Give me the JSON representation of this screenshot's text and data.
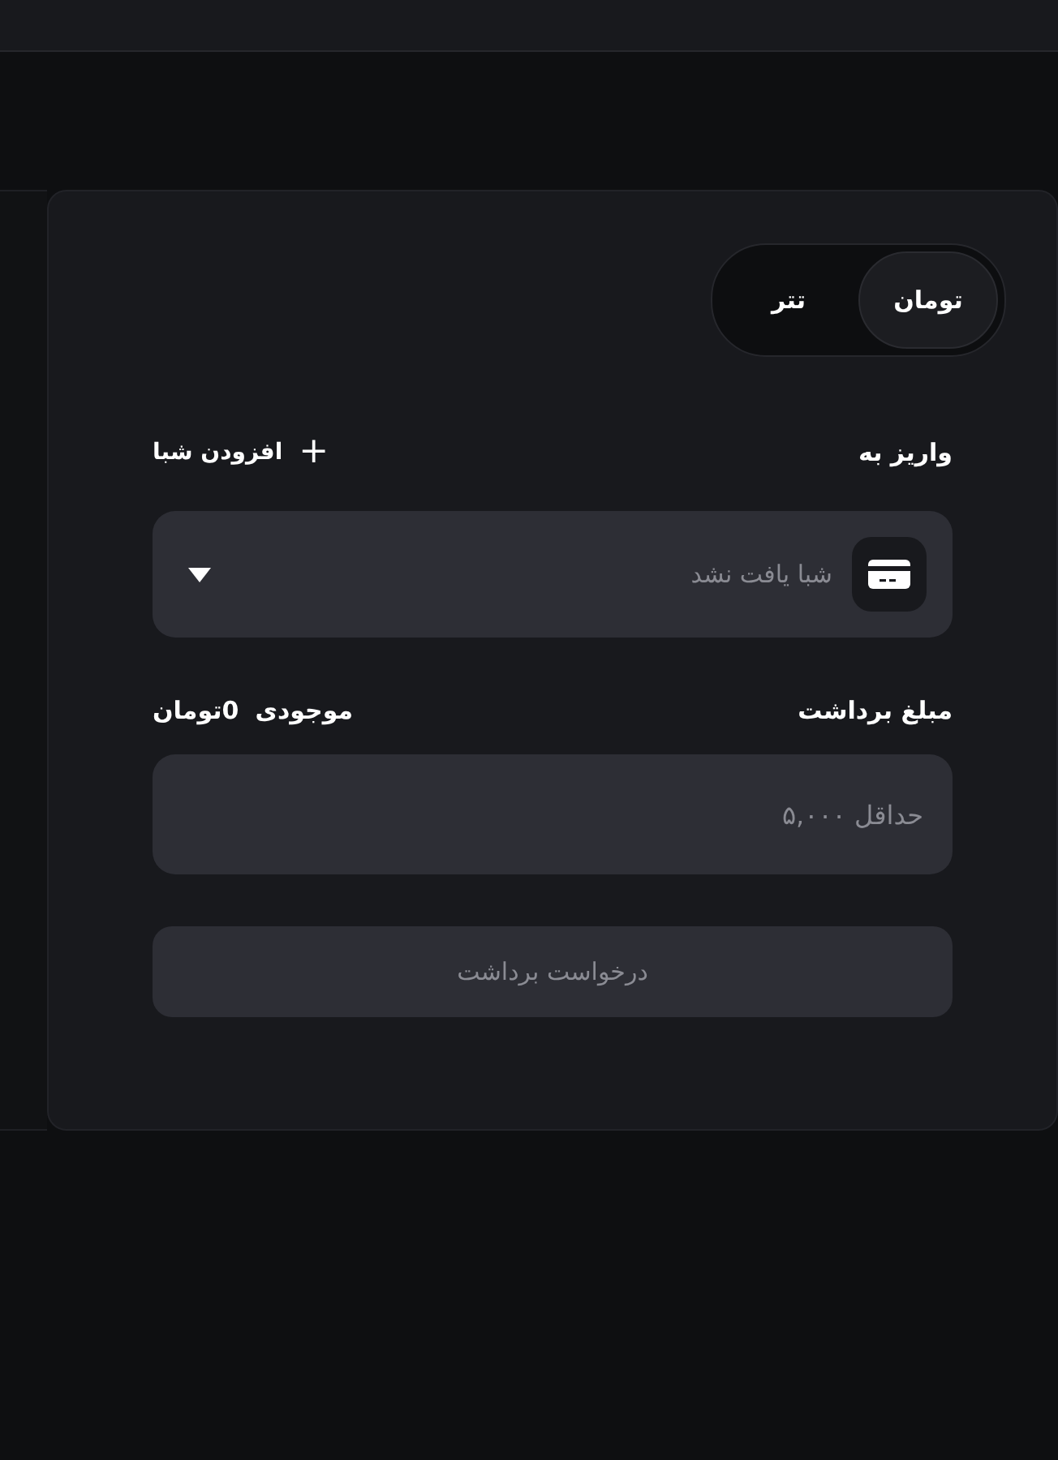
{
  "currency_tabs": [
    {
      "label": "تومان",
      "selected": true
    },
    {
      "label": "تتر",
      "selected": false
    }
  ],
  "destination": {
    "label": "واریز به",
    "add_button": "افزودن شبا",
    "add_icon": "+",
    "select": {
      "placeholder": "شبا یافت نشد"
    }
  },
  "amount": {
    "label": "مبلغ برداشت",
    "balance_label": "موجودی",
    "balance_value": "0تومان",
    "placeholder": "حداقل ۵,۰۰۰"
  },
  "submit": {
    "label": "درخواست برداشت",
    "disabled": true
  }
}
